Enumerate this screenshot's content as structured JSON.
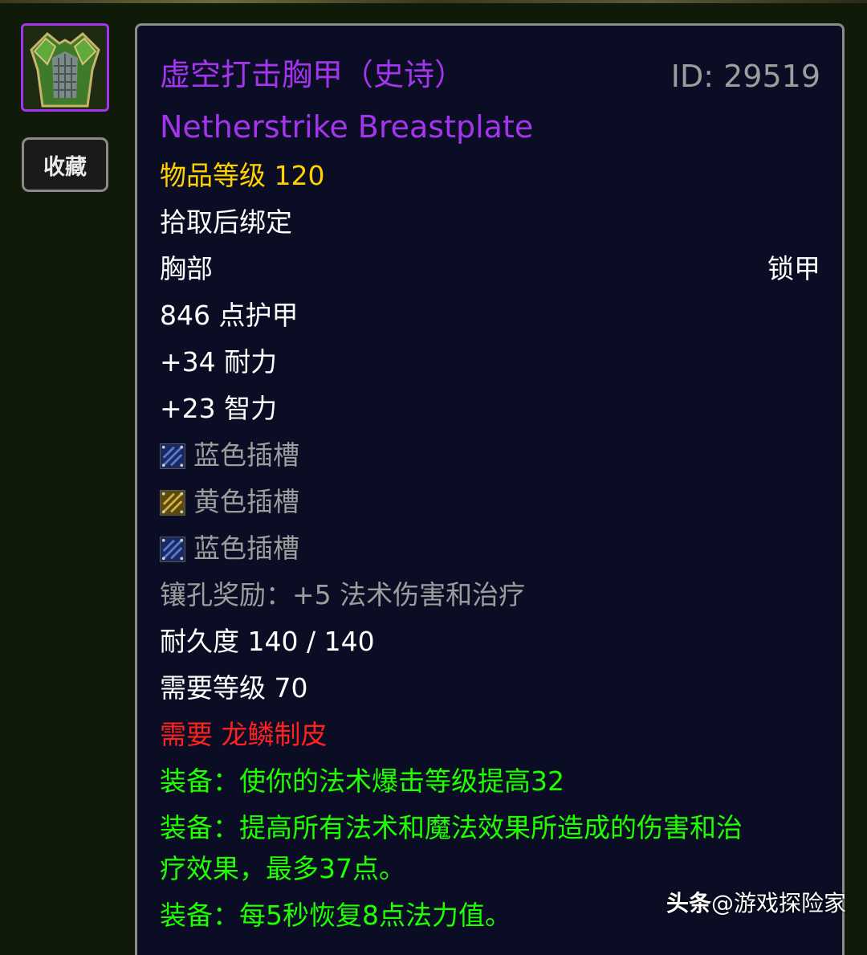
{
  "item": {
    "name_cn": "虚空打击胸甲（史诗）",
    "name_en": "Netherstrike Breastplate",
    "id_label": "ID: 29519",
    "item_level": "物品等级 120",
    "binding": "拾取后绑定",
    "slot": "胸部",
    "armor_type": "锁甲",
    "armor": "846 点护甲",
    "stamina": "+34 耐力",
    "intellect": "+23 智力",
    "sockets": [
      {
        "label": "蓝色插槽",
        "color": "#2a4aa0",
        "icon": "blue-socket-icon"
      },
      {
        "label": "黄色插槽",
        "color": "#a08a20",
        "icon": "yellow-socket-icon"
      },
      {
        "label": "蓝色插槽",
        "color": "#2a4aa0",
        "icon": "blue-socket-icon"
      }
    ],
    "socket_bonus": "镶孔奖励：+5 法术伤害和治疗",
    "durability": "耐久度 140 / 140",
    "required_level": "需要等级 70",
    "required_skill": "需要 龙鳞制皮",
    "equip_1": "装备：使你的法术爆击等级提高32",
    "equip_2a": "装备：提高所有法术和魔法效果所造成的伤害和治",
    "equip_2b": "疗效果，最多37点。",
    "equip_3": "装备：每5秒恢复8点法力值。"
  },
  "sidebar": {
    "favorite_label": "收藏",
    "item_icon": "green-mail-chest-icon"
  },
  "watermark": {
    "brand": "头条",
    "account": "@游戏探险家"
  },
  "colors": {
    "epic": "#a335ee",
    "item_level": "#ffd100",
    "requirement_unmet": "#ff2020",
    "equip_effect": "#1eff00",
    "tooltip_bg": "#0a0d24",
    "page_bg": "#0f1a08"
  }
}
